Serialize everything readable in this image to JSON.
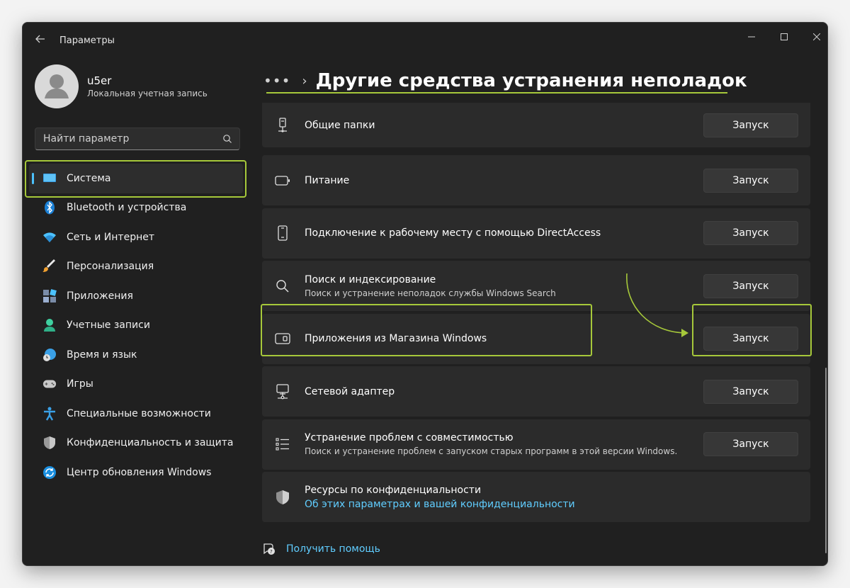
{
  "window": {
    "app_title": "Параметры",
    "back_icon": "arrow-left-icon"
  },
  "user": {
    "name": "u5er",
    "account_type": "Локальная учетная запись"
  },
  "search": {
    "placeholder": "Найти параметр"
  },
  "sidebar": {
    "items": [
      {
        "label": "Система",
        "icon": "monitor-icon",
        "active": true
      },
      {
        "label": "Bluetooth и устройства",
        "icon": "bluetooth-icon"
      },
      {
        "label": "Сеть и Интернет",
        "icon": "wifi-icon"
      },
      {
        "label": "Персонализация",
        "icon": "brush-icon"
      },
      {
        "label": "Приложения",
        "icon": "apps-icon"
      },
      {
        "label": "Учетные записи",
        "icon": "person-icon"
      },
      {
        "label": "Время и язык",
        "icon": "globe-clock-icon"
      },
      {
        "label": "Игры",
        "icon": "gamepad-icon"
      },
      {
        "label": "Специальные возможности",
        "icon": "accessibility-icon"
      },
      {
        "label": "Конфиденциальность и защита",
        "icon": "shield-icon"
      },
      {
        "label": "Центр обновления Windows",
        "icon": "update-icon"
      }
    ]
  },
  "header": {
    "more": "•••",
    "separator": "›",
    "title": "Другие средства устранения неполадок"
  },
  "troubleshooters": [
    {
      "title": "Общие папки",
      "subtitle": "",
      "icon": "shared-folder-icon",
      "button": "Запуск"
    },
    {
      "title": "Питание",
      "subtitle": "",
      "icon": "battery-icon",
      "button": "Запуск"
    },
    {
      "title": "Подключение к рабочему месту с помощью DirectAccess",
      "subtitle": "",
      "icon": "phone-device-icon",
      "button": "Запуск"
    },
    {
      "title": "Поиск и индексирование",
      "subtitle": "Поиск и устранение неполадок службы Windows Search",
      "icon": "search-icon",
      "button": "Запуск"
    },
    {
      "title": "Приложения из Магазина Windows",
      "subtitle": "",
      "icon": "store-app-icon",
      "button": "Запуск"
    },
    {
      "title": "Сетевой адаптер",
      "subtitle": "",
      "icon": "network-adapter-icon",
      "button": "Запуск"
    },
    {
      "title": "Устранение проблем с совместимостью",
      "subtitle": "Поиск и устранение проблем с запуском старых программ в этой версии Windows.",
      "icon": "list-icon",
      "button": "Запуск"
    }
  ],
  "privacy": {
    "title": "Ресурсы по конфиденциальности",
    "link": "Об этих параметрах и вашей конфиденциальности",
    "icon": "shield-icon"
  },
  "help": {
    "label": "Получить помощь",
    "icon": "help-icon"
  },
  "colors": {
    "accent": "#4cc2ff",
    "link": "#60cdff",
    "highlight": "#a6c83a",
    "background": "#202020",
    "card": "#2b2b2b"
  }
}
